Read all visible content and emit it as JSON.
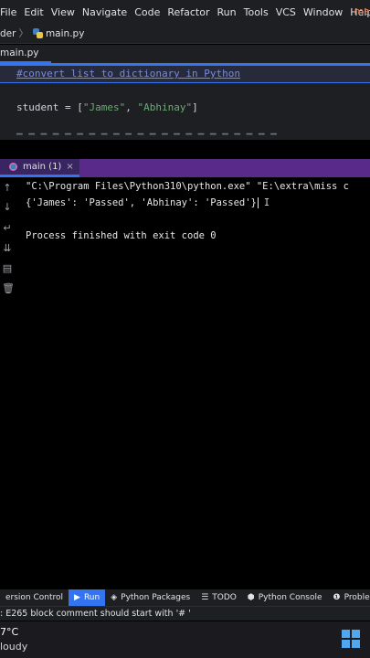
{
  "menubar": {
    "items": [
      "File",
      "Edit",
      "View",
      "Navigate",
      "Code",
      "Refactor",
      "Run",
      "Tools",
      "VCS",
      "Window",
      "Help"
    ],
    "title_fragment": "ma"
  },
  "breadcrumb": {
    "folder": "der",
    "file": "main.py"
  },
  "tab": {
    "filename": "main.py"
  },
  "editor": {
    "line1_comment": "#convert list to dictionary in Python",
    "line2_prefix": "student = [",
    "line2_s1": "\"James\"",
    "line2_sep": ", ",
    "line2_s2": "\"Abhinay\"",
    "line2_suffix": "]"
  },
  "run": {
    "tab_label": "main (1)",
    "close_glyph": "×"
  },
  "console": {
    "command_line": "\"C:\\Program Files\\Python310\\python.exe\" \"E:\\extra\\miss c",
    "output_line": "{'James': 'Passed', 'Abhinay': 'Passed'}",
    "exit_line": "Process finished with exit code 0"
  },
  "bottom_toolbar": {
    "items": [
      "ersion Control",
      "Run",
      "Python Packages",
      "TODO",
      "Python Console",
      "Proble"
    ]
  },
  "statusbar": {
    "message": ": E265 block comment should start with '# '"
  },
  "taskbar": {
    "temp": "7°C",
    "condition": "loudy"
  },
  "colors": {
    "accent": "#3574f0",
    "string": "#6aab73",
    "comment": "#7a8bd9"
  }
}
